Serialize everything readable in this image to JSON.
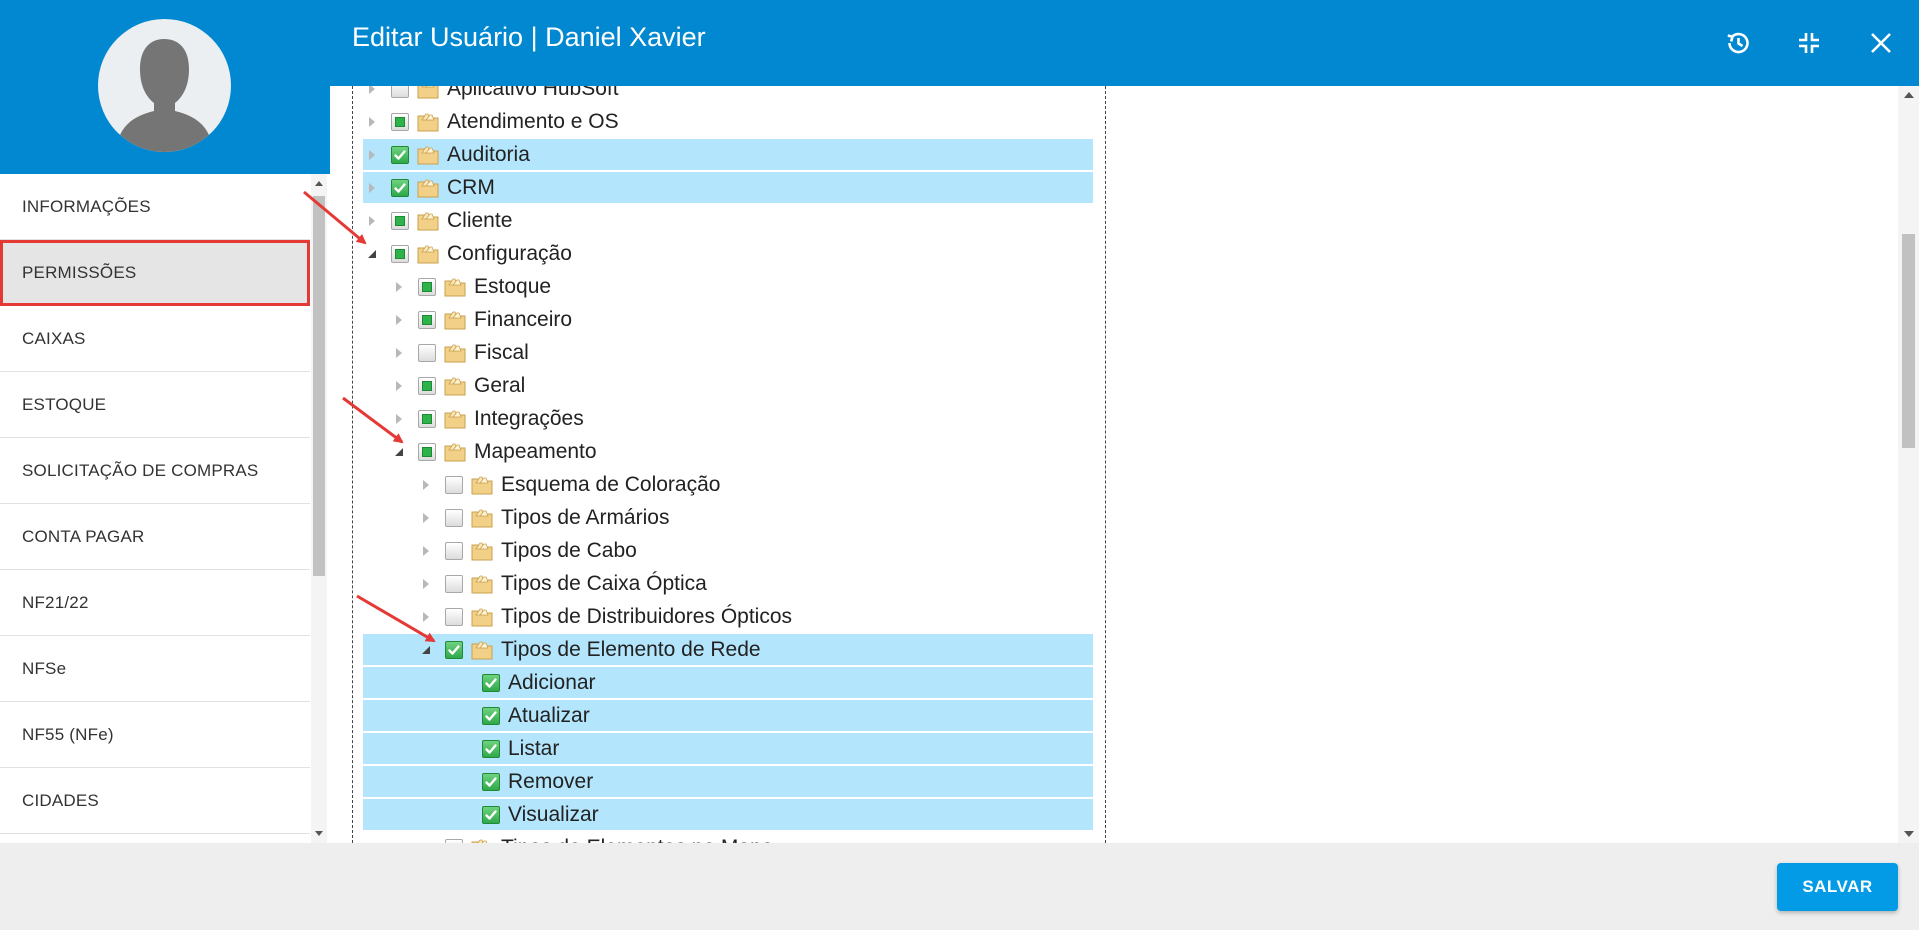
{
  "header": {
    "title": "Editar Usuário | Daniel Xavier",
    "buttons": [
      {
        "name": "history-icon"
      },
      {
        "name": "minimize-icon"
      },
      {
        "name": "close-icon"
      }
    ],
    "color": "#0288d1"
  },
  "sidebar": {
    "items": [
      {
        "label": "INFORMAÇÕES",
        "active": false
      },
      {
        "label": "PERMISSÕES",
        "active": true
      },
      {
        "label": "CAIXAS",
        "active": false
      },
      {
        "label": "ESTOQUE",
        "active": false
      },
      {
        "label": "SOLICITAÇÃO DE COMPRAS",
        "active": false
      },
      {
        "label": "CONTA PAGAR",
        "active": false
      },
      {
        "label": "NF21/22",
        "active": false
      },
      {
        "label": "NFSe",
        "active": false
      },
      {
        "label": "NF55 (NFe)",
        "active": false
      },
      {
        "label": "CIDADES",
        "active": false
      }
    ]
  },
  "tree": {
    "nodes": [
      {
        "label": "Aplicativo HubSoft",
        "level": 0,
        "expanded": false,
        "check": "none",
        "selected": false
      },
      {
        "label": "Atendimento e OS",
        "level": 0,
        "expanded": false,
        "check": "partial",
        "selected": false
      },
      {
        "label": "Auditoria",
        "level": 0,
        "expanded": false,
        "check": "checked",
        "selected": true
      },
      {
        "label": "CRM",
        "level": 0,
        "expanded": false,
        "check": "checked",
        "selected": true
      },
      {
        "label": "Cliente",
        "level": 0,
        "expanded": false,
        "check": "partial",
        "selected": false
      },
      {
        "label": "Configuração",
        "level": 0,
        "expanded": true,
        "check": "partial",
        "selected": false
      },
      {
        "label": "Estoque",
        "level": 1,
        "expanded": false,
        "check": "partial",
        "selected": false
      },
      {
        "label": "Financeiro",
        "level": 1,
        "expanded": false,
        "check": "partial",
        "selected": false
      },
      {
        "label": "Fiscal",
        "level": 1,
        "expanded": false,
        "check": "none",
        "selected": false
      },
      {
        "label": "Geral",
        "level": 1,
        "expanded": false,
        "check": "partial",
        "selected": false
      },
      {
        "label": "Integrações",
        "level": 1,
        "expanded": false,
        "check": "partial",
        "selected": false
      },
      {
        "label": "Mapeamento",
        "level": 1,
        "expanded": true,
        "check": "partial",
        "selected": false
      },
      {
        "label": "Esquema de Coloração",
        "level": 2,
        "expanded": false,
        "check": "none",
        "selected": false
      },
      {
        "label": "Tipos de Armários",
        "level": 2,
        "expanded": false,
        "check": "none",
        "selected": false
      },
      {
        "label": "Tipos de Cabo",
        "level": 2,
        "expanded": false,
        "check": "none",
        "selected": false
      },
      {
        "label": "Tipos de Caixa Óptica",
        "level": 2,
        "expanded": false,
        "check": "none",
        "selected": false
      },
      {
        "label": "Tipos de Distribuidores Ópticos",
        "level": 2,
        "expanded": false,
        "check": "none",
        "selected": false
      },
      {
        "label": "Tipos de Elemento de Rede",
        "level": 2,
        "expanded": true,
        "check": "checked",
        "selected": true
      },
      {
        "label": "Adicionar",
        "level": 3,
        "leaf": true,
        "check": "checked",
        "selected": true
      },
      {
        "label": "Atualizar",
        "level": 3,
        "leaf": true,
        "check": "checked",
        "selected": true
      },
      {
        "label": "Listar",
        "level": 3,
        "leaf": true,
        "check": "checked",
        "selected": true
      },
      {
        "label": "Remover",
        "level": 3,
        "leaf": true,
        "check": "checked",
        "selected": true
      },
      {
        "label": "Visualizar",
        "level": 3,
        "leaf": true,
        "check": "checked",
        "selected": true
      },
      {
        "label": "Tipos de Elementos no Mapa",
        "level": 2,
        "expanded": false,
        "check": "none",
        "selected": false
      }
    ]
  },
  "footer": {
    "save_label": "SALVAR",
    "save_color": "#039be5"
  },
  "colors": {
    "selection": "#b3e5fc",
    "active_outline": "#e53935",
    "annotation_arrow": "#e53935"
  }
}
